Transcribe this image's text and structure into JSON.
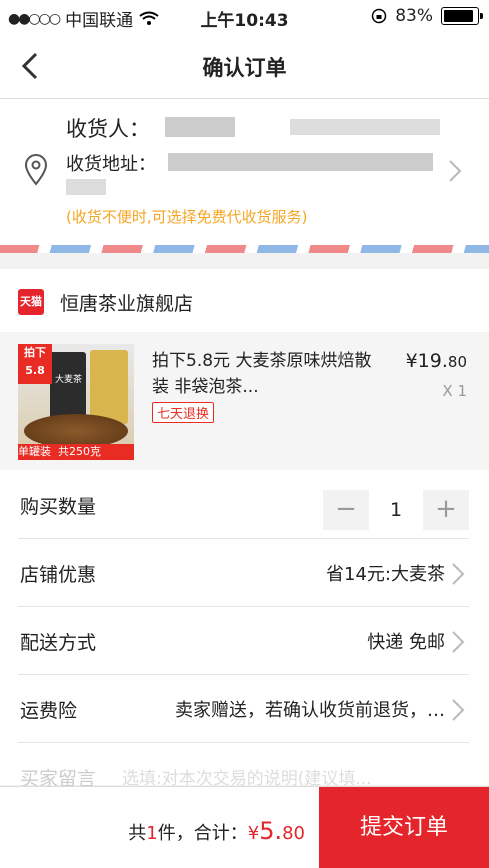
{
  "status_bar": {
    "carrier": "中国联通",
    "time": "上午10:43",
    "battery": "83%"
  },
  "nav": {
    "title": "确认订单"
  },
  "address": {
    "receiver_label": "收货人：",
    "address_label": "收货地址：",
    "hint": "(收货不便时,可选择免费代收货服务)"
  },
  "store": {
    "badge": "天猫",
    "name": "恒唐茶业旗舰店"
  },
  "product": {
    "name": "拍下5.8元 大麦茶原味烘焙散装 非袋泡茶...",
    "return_badge": "七天退换",
    "price_int": "¥19.",
    "price_dec": "80",
    "quantity": "X 1",
    "image_tag_top": "拍下\n5.8",
    "image_can_label": "大麦茶",
    "image_bottom_tag": "单罐装  共250克"
  },
  "rows": {
    "qty_label": "购买数量",
    "qty_value": "1",
    "minus": "−",
    "plus": "+",
    "shop_discount_label": "店铺优惠",
    "shop_discount_value": "省14元:大麦茶",
    "delivery_label": "配送方式",
    "delivery_value": "快递 免邮",
    "freight_label": "运费险",
    "freight_value": "卖家赠送，若确认收货前退货，…",
    "message_label": "买家留言",
    "message_placeholder": "选填:对本次交易的说明(建议填..."
  },
  "bottom": {
    "total_prefix": "共",
    "total_count": "1",
    "total_mid": "件，合计：",
    "total_currency": "¥",
    "total_int": "5.",
    "total_dec": "80",
    "submit": "提交订单"
  },
  "colors": {
    "accent": "#e4262c",
    "hint": "#f5a623"
  }
}
